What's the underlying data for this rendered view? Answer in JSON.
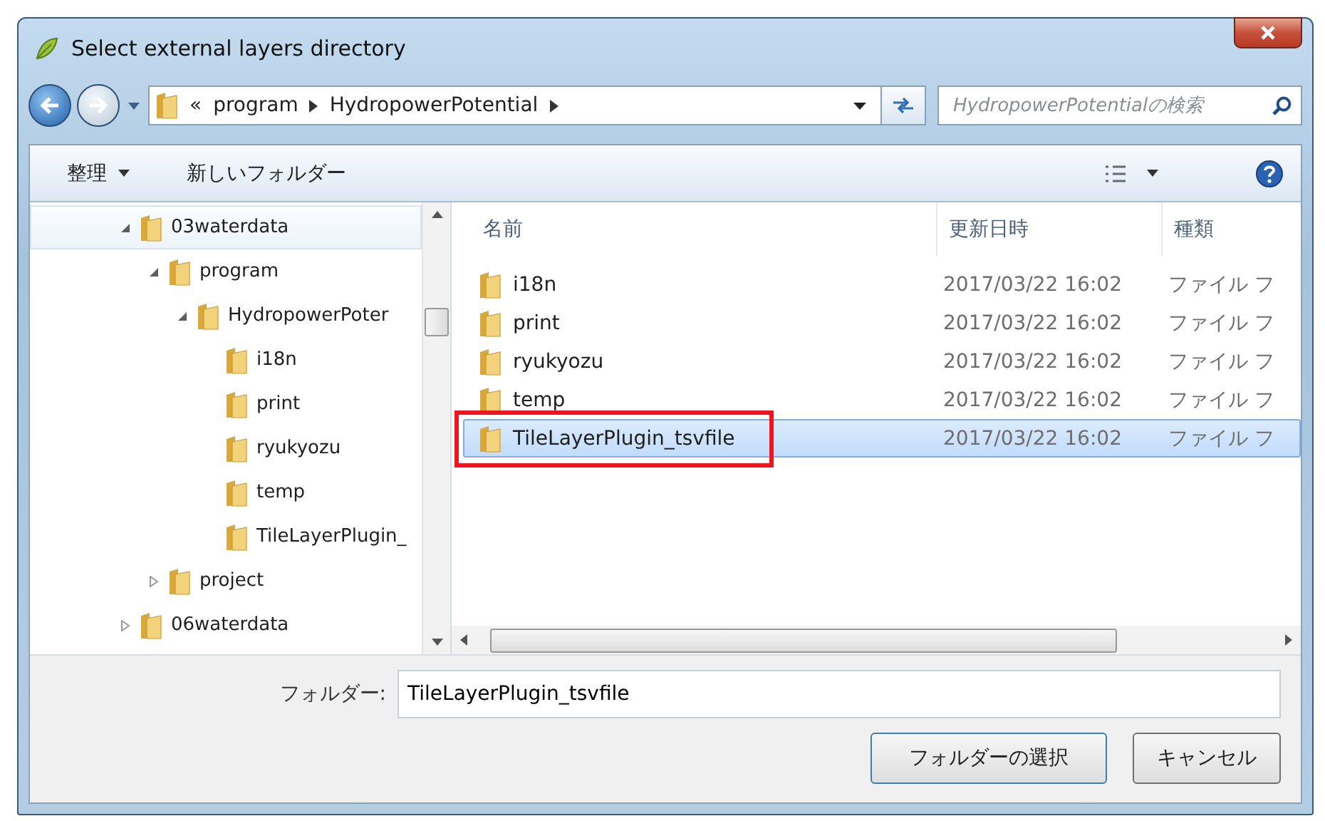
{
  "window": {
    "title": "Select external layers directory"
  },
  "address": {
    "overflow": "«",
    "crumbs": [
      "program",
      "HydropowerPotential"
    ]
  },
  "search": {
    "placeholder": "HydropowerPotentialの検索"
  },
  "toolbar": {
    "organize": "整理",
    "new_folder": "新しいフォルダー"
  },
  "tree": [
    {
      "label": "03waterdata",
      "expanded": true,
      "selected": true,
      "children": [
        {
          "label": "program",
          "expanded": true,
          "selected": false,
          "children": [
            {
              "label": "HydropowerPoter",
              "expanded": true,
              "selected": false,
              "children": [
                {
                  "label": "i18n",
                  "selected": false
                },
                {
                  "label": "print",
                  "selected": false
                },
                {
                  "label": "ryukyozu",
                  "selected": false
                },
                {
                  "label": "temp",
                  "selected": false
                },
                {
                  "label": "TileLayerPlugin_",
                  "selected": false
                }
              ]
            }
          ]
        },
        {
          "label": "project",
          "expanded": false,
          "selected": false
        }
      ]
    },
    {
      "label": "06waterdata",
      "expanded": false,
      "selected": false
    }
  ],
  "table": {
    "columns": [
      "名前",
      "更新日時",
      "種類"
    ],
    "rows": [
      {
        "name": "i18n",
        "date": "2017/03/22 16:02",
        "type": "ファイル フ",
        "selected": false
      },
      {
        "name": "print",
        "date": "2017/03/22 16:02",
        "type": "ファイル フ",
        "selected": false
      },
      {
        "name": "ryukyozu",
        "date": "2017/03/22 16:02",
        "type": "ファイル フ",
        "selected": false
      },
      {
        "name": "temp",
        "date": "2017/03/22 16:02",
        "type": "ファイル フ",
        "selected": false
      },
      {
        "name": "TileLayerPlugin_tsvfile",
        "date": "2017/03/22 16:02",
        "type": "ファイル フ",
        "selected": true
      }
    ]
  },
  "folder_field": {
    "label": "フォルダー:",
    "value": "TileLayerPlugin_tsvfile"
  },
  "buttons": [
    "フォルダーの選択",
    "キャンセル"
  ]
}
